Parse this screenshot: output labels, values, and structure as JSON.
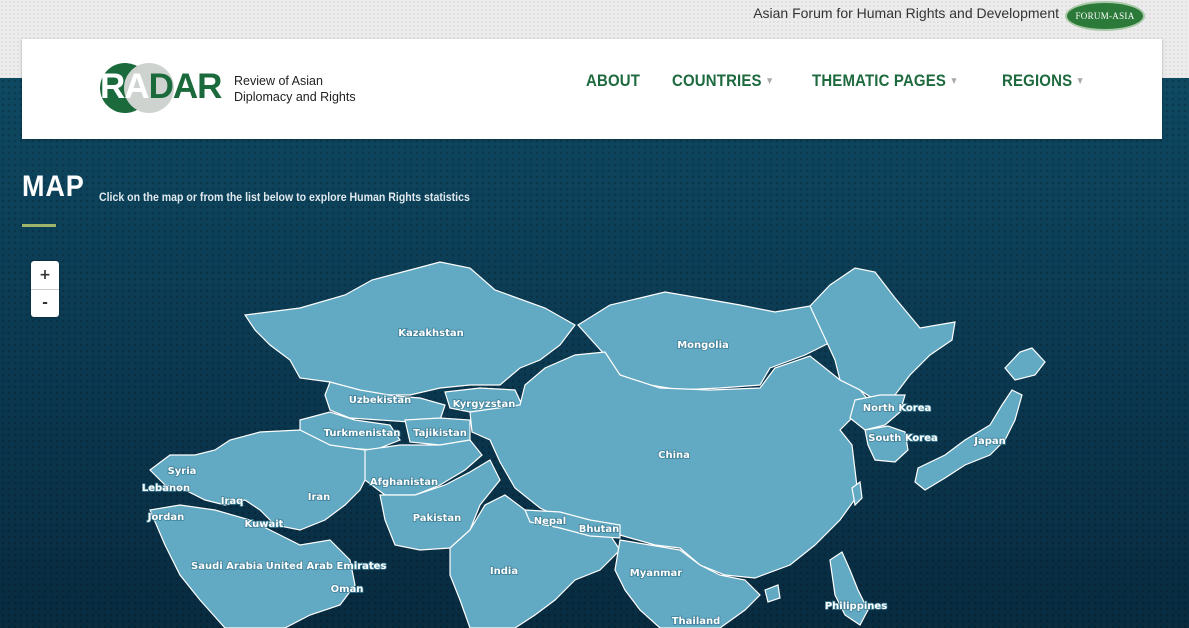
{
  "top_bar": {
    "org_link": "Asian Forum for Human Rights and Development",
    "org_logo_text": "FORUM-ASIA"
  },
  "header": {
    "logo": {
      "part1": "RA",
      "part2": "DAR"
    },
    "tagline_line1": "Review of Asian",
    "tagline_line2": "Diplomacy and Rights",
    "menu": [
      {
        "label": "ABOUT",
        "dropdown": false
      },
      {
        "label": "COUNTRIES",
        "dropdown": true
      },
      {
        "label": "THEMATIC PAGES",
        "dropdown": true
      },
      {
        "label": "REGIONS",
        "dropdown": true
      }
    ]
  },
  "map_section": {
    "title": "MAP",
    "subtitle": "Click on the map or from the list below to explore Human Rights statistics",
    "zoom_in": "+",
    "zoom_out": "-"
  },
  "countries": [
    "Kazakhstan",
    "Mongolia",
    "Uzbekistan",
    "Kyrgyzstan",
    "Turkmenistan",
    "Tajikistan",
    "North Korea",
    "South Korea",
    "Japan",
    "China",
    "Syria",
    "Lebanon",
    "Iraq",
    "Iran",
    "Afghanistan",
    "Jordan",
    "Kuwait",
    "Pakistan",
    "Nepal",
    "Bhutan",
    "Saudi Arabia",
    "United Arab Emirates",
    "India",
    "Myanmar",
    "Oman",
    "Philippines",
    "Thailand"
  ],
  "colors": {
    "land": "#62a9c3",
    "border": "#ffffff",
    "brand_green": "#1e6a3f",
    "ocean": "#0b3a52"
  }
}
